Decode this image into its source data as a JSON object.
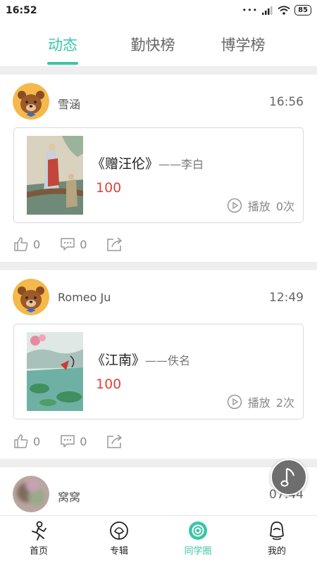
{
  "status_bar": {
    "time": "16:52",
    "signal_dots": "•••",
    "battery": "85"
  },
  "tabs": [
    {
      "label": "动态",
      "active": true
    },
    {
      "label": "勤快榜",
      "active": false
    },
    {
      "label": "博学榜",
      "active": false
    }
  ],
  "posts": [
    {
      "username": "雪涵",
      "time": "16:56",
      "work": {
        "title": "《赠汪伦》",
        "author": "——李白",
        "score": "100",
        "play_label": "播放",
        "play_count": "0次"
      },
      "likes": "0",
      "comments": "0"
    },
    {
      "username": "Romeo Ju",
      "time": "12:49",
      "work": {
        "title": "《江南》",
        "author": "——佚名",
        "score": "100",
        "play_label": "播放",
        "play_count": "2次"
      },
      "likes": "0",
      "comments": "0"
    },
    {
      "username": "窝窝",
      "time": "07:44"
    }
  ],
  "bottom_nav": [
    {
      "label": "首页",
      "icon": "home-icon",
      "active": false
    },
    {
      "label": "专辑",
      "icon": "album-icon",
      "active": false
    },
    {
      "label": "同学圈",
      "icon": "classmates-icon",
      "active": true
    },
    {
      "label": "我的",
      "icon": "profile-icon",
      "active": false
    }
  ],
  "colors": {
    "accent": "#3bc5a6",
    "score": "#e0433a",
    "separator": "#eeeeee"
  }
}
